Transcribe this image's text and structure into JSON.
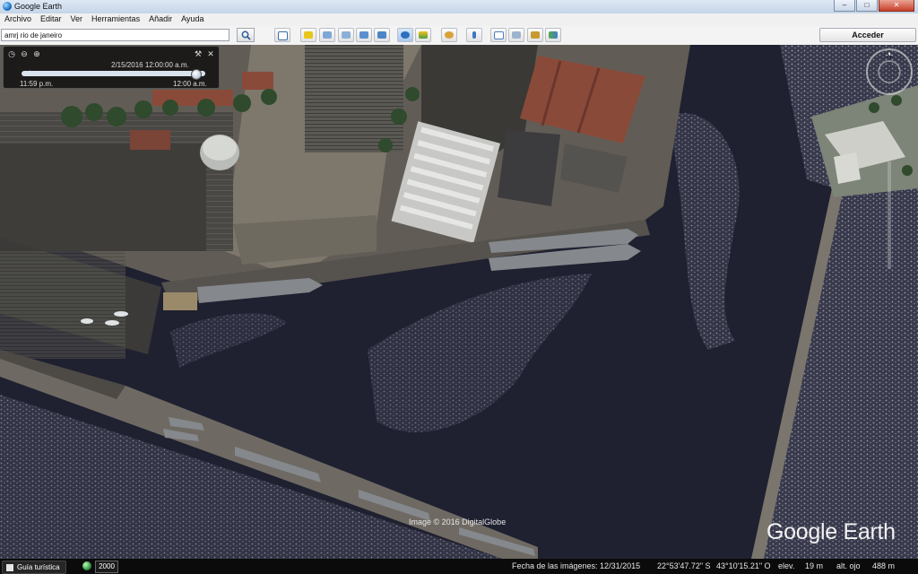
{
  "window": {
    "title": "Google Earth",
    "minimize": "–",
    "maximize": "□",
    "close": "✕"
  },
  "menu": [
    "Archivo",
    "Editar",
    "Ver",
    "Herramientas",
    "Añadir",
    "Ayuda"
  ],
  "search": {
    "value": "amrj rio de janeiro",
    "button_icon": "search-icon"
  },
  "toolbar": {
    "icons": [
      "sidebar-toggle-icon",
      "placemark-icon",
      "polygon-icon",
      "path-icon",
      "image-overlay-icon",
      "record-tour-icon",
      "historical-imagery-icon",
      "sunlight-icon",
      "planets-icon",
      "ruler-icon",
      "email-icon",
      "print-icon",
      "save-image-icon",
      "view-in-maps-icon"
    ],
    "signin_label": "Acceder"
  },
  "time_slider": {
    "date": "2/15/2016  12:00:00 a.m.",
    "start_label": "11:59 p.m.",
    "end_label": "12:00 a.m.",
    "position_fraction": 0.95
  },
  "compass": {
    "north_label": "N"
  },
  "attribution": {
    "image_credit": "Image © 2016 DigitalGlobe",
    "logo": "Google Earth"
  },
  "status": {
    "tour_guide": "Guía turística",
    "year": "2000",
    "imagery_date": "Fecha de las imágenes: 12/31/2015",
    "lat": "22°53'47.72\" S",
    "lon": "43°10'15.21\" O",
    "elev_label": "elev.",
    "elev_value": "19 m",
    "eye_label": "alt. ojo",
    "eye_value": "488 m"
  },
  "colors": {
    "water": "#1f2030",
    "pier": "#6e6a63",
    "roof_red": "#8a4a3a"
  }
}
